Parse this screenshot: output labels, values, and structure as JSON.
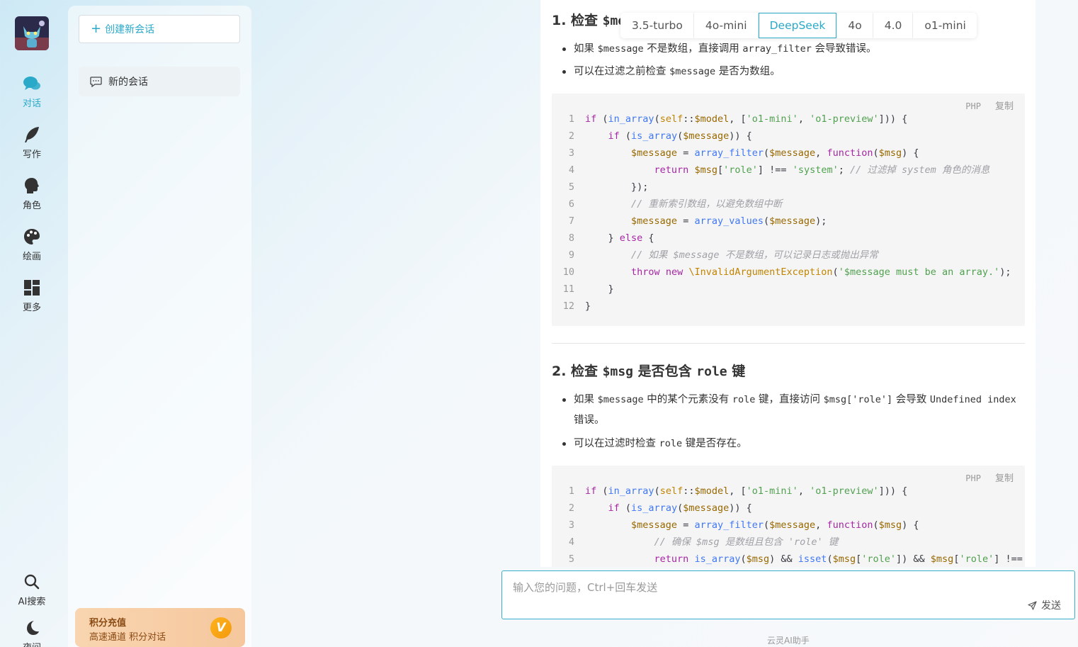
{
  "nav": {
    "items": [
      {
        "label": "对话",
        "icon": "chat-bubbles-icon"
      },
      {
        "label": "写作",
        "icon": "feather-icon"
      },
      {
        "label": "角色",
        "icon": "head-profile-icon"
      },
      {
        "label": "绘画",
        "icon": "palette-icon"
      },
      {
        "label": "更多",
        "icon": "grid-icon"
      }
    ],
    "bottom": [
      {
        "label": "AI搜索",
        "icon": "search-icon"
      },
      {
        "label": "夜间",
        "icon": "moon-icon"
      }
    ]
  },
  "sidebar": {
    "new_chat_label": "创建新会话",
    "conversations": [
      {
        "title": "新的会话"
      }
    ],
    "promo": {
      "title": "积分充值",
      "subtitle": "高速通道 积分对话",
      "badge": "V"
    }
  },
  "models": {
    "tabs": [
      "3.5-turbo",
      "4o-mini",
      "DeepSeek",
      "4o",
      "4.0",
      "o1-mini"
    ],
    "active": "DeepSeek"
  },
  "content": {
    "section1": {
      "heading_prefix": "1. 检查 ",
      "heading_code": "$me",
      "bullets": [
        [
          "如果 ",
          "$message",
          " 不是数组，直接调用 ",
          "array_filter",
          " 会导致错误。"
        ],
        [
          "可以在过滤之前检查 ",
          "$message",
          " 是否为数组。"
        ]
      ],
      "code": {
        "lang": "PHP",
        "copy_label": "复制",
        "lines": [
          "if (in_array(self::$model, ['o1-mini', 'o1-preview'])) {",
          "    if (is_array($message)) {",
          "        $message = array_filter($message, function($msg) {",
          "            return $msg['role'] !== 'system'; // 过滤掉 system 角色的消息",
          "        });",
          "        // 重新索引数组，以避免数组中断",
          "        $message = array_values($message);",
          "    } else {",
          "        // 如果 $message 不是数组，可以记录日志或抛出异常",
          "        throw new \\InvalidArgumentException('$message must be an array.');",
          "    }",
          "}"
        ]
      }
    },
    "section2": {
      "heading_prefix": "2. 检查 ",
      "heading_code1": "$msg",
      "heading_mid": " 是否包含 ",
      "heading_code2": "role",
      "heading_suffix": " 键",
      "bullets": [
        [
          "如果 ",
          "$message",
          " 中的某个元素没有 ",
          "role",
          " 键，直接访问 ",
          "$msg['role']",
          " 会导致 ",
          "Undefined index",
          " 错误。"
        ],
        [
          "可以在过滤时检查 ",
          "role",
          " 键是否存在。"
        ]
      ],
      "code": {
        "lang": "PHP",
        "copy_label": "复制",
        "lines": [
          "if (in_array(self::$model, ['o1-mini', 'o1-preview'])) {",
          "    if (is_array($message)) {",
          "        $message = array_filter($message, function($msg) {",
          "            // 确保 $msg 是数组且包含 'role' 键",
          "            return is_array($msg) && isset($msg['role']) && $msg['role'] !== 'sy"
        ]
      }
    }
  },
  "input": {
    "placeholder": "输入您的问题，Ctrl+回车发送",
    "send_label": "发送"
  },
  "footer": {
    "brand": "云灵AI助手"
  },
  "colors": {
    "accent": "#2aa9c9",
    "promo": "#f6c79d"
  }
}
